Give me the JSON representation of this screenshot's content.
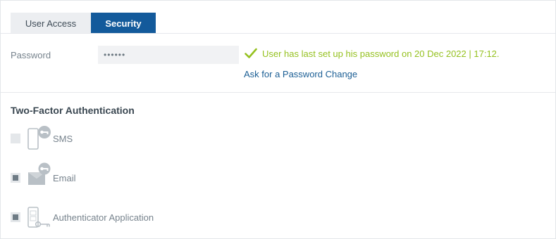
{
  "tabs": [
    {
      "label": "User Access",
      "active": false
    },
    {
      "label": "Security",
      "active": true
    }
  ],
  "password": {
    "label": "Password",
    "value": "••••••",
    "status_text": "User has last set up his password on 20 Dec 2022 | 17:12.",
    "status_icon": "check-icon",
    "change_link": "Ask for a Password Change"
  },
  "two_factor": {
    "heading": "Two-Factor Authentication",
    "options": [
      {
        "label": "SMS",
        "checked": false,
        "icon": "sms-key-icon"
      },
      {
        "label": "Email",
        "checked": true,
        "icon": "email-key-icon"
      },
      {
        "label": "Authenticator Application",
        "checked": true,
        "icon": "authenticator-app-icon"
      }
    ]
  },
  "colors": {
    "active_tab": "#135a9b",
    "success": "#95c11f",
    "link": "#1b5e94",
    "muted_text": "#77838d",
    "icon_gray": "#b9c0c6"
  }
}
